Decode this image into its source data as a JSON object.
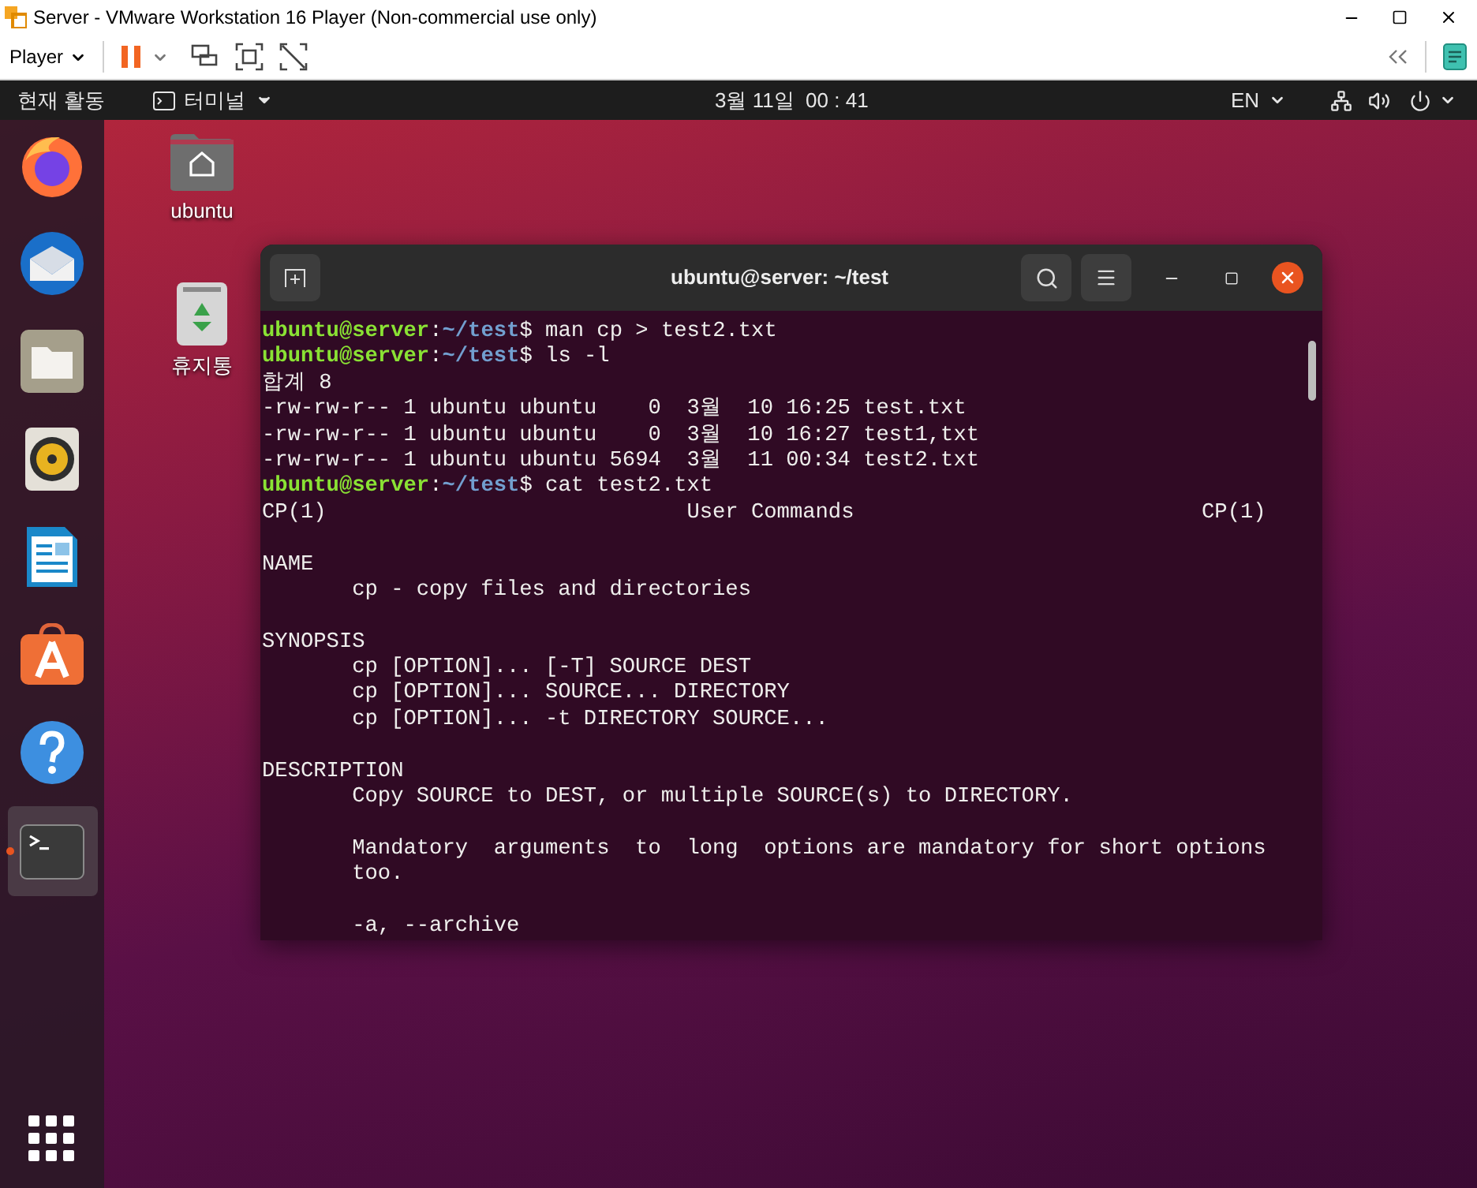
{
  "vm_window": {
    "title": "Server - VMware Workstation 16 Player (Non-commercial use only)",
    "player_menu": "Player",
    "paused": false
  },
  "top_bar": {
    "activities": "현재 활동",
    "app_menu": "터미널",
    "clock": "3월 11일  00 : 41",
    "input_source": "EN"
  },
  "dock": [
    {
      "kind": "firefox",
      "selected": false,
      "running": false
    },
    {
      "kind": "thunderbird",
      "selected": false,
      "running": false
    },
    {
      "kind": "files",
      "selected": false,
      "running": false
    },
    {
      "kind": "rhythmbox",
      "selected": false,
      "running": false
    },
    {
      "kind": "writer",
      "selected": false,
      "running": false
    },
    {
      "kind": "software",
      "selected": false,
      "running": false
    },
    {
      "kind": "help",
      "selected": false,
      "running": false
    },
    {
      "kind": "terminal",
      "selected": true,
      "running": true
    }
  ],
  "desktop_icons": [
    {
      "kind": "home",
      "label": "ubuntu"
    },
    {
      "kind": "trash",
      "label": "휴지통"
    }
  ],
  "terminal": {
    "title": "ubuntu@server: ~/test",
    "lines": [
      {
        "kind": "prompt",
        "user": "ubuntu@server",
        "separator": ":",
        "path": "~/test",
        "sigil": "$",
        "command": "man cp > test2.txt"
      },
      {
        "kind": "prompt",
        "user": "ubuntu@server",
        "separator": ":",
        "path": "~/test",
        "sigil": "$",
        "command": "ls -l"
      },
      {
        "kind": "output",
        "text": "합계 8"
      },
      {
        "kind": "output",
        "text": "-rw-rw-r-- 1 ubuntu ubuntu    0  3월  10 16:25 test.txt"
      },
      {
        "kind": "output",
        "text": "-rw-rw-r-- 1 ubuntu ubuntu    0  3월  10 16:27 test1,txt"
      },
      {
        "kind": "output",
        "text": "-rw-rw-r-- 1 ubuntu ubuntu 5694  3월  11 00:34 test2.txt"
      },
      {
        "kind": "prompt",
        "user": "ubuntu@server",
        "separator": ":",
        "path": "~/test",
        "sigil": "$",
        "command": "cat test2.txt"
      },
      {
        "kind": "output",
        "text": "CP(1)                            User Commands                           CP(1)"
      },
      {
        "kind": "blank"
      },
      {
        "kind": "output",
        "text": "NAME"
      },
      {
        "kind": "indented",
        "text": "cp - copy files and directories"
      },
      {
        "kind": "blank"
      },
      {
        "kind": "output",
        "text": "SYNOPSIS"
      },
      {
        "kind": "indented",
        "text": "cp [OPTION]... [-T] SOURCE DEST"
      },
      {
        "kind": "indented",
        "text": "cp [OPTION]... SOURCE... DIRECTORY"
      },
      {
        "kind": "indented",
        "text": "cp [OPTION]... -t DIRECTORY SOURCE..."
      },
      {
        "kind": "blank"
      },
      {
        "kind": "output",
        "text": "DESCRIPTION"
      },
      {
        "kind": "indented",
        "text": "Copy SOURCE to DEST, or multiple SOURCE(s) to DIRECTORY."
      },
      {
        "kind": "blank"
      },
      {
        "kind": "indented",
        "text": "Mandatory  arguments  to  long  options are mandatory for short options"
      },
      {
        "kind": "indented",
        "text": "too."
      },
      {
        "kind": "blank"
      },
      {
        "kind": "indented",
        "text": "-a, --archive"
      }
    ]
  }
}
